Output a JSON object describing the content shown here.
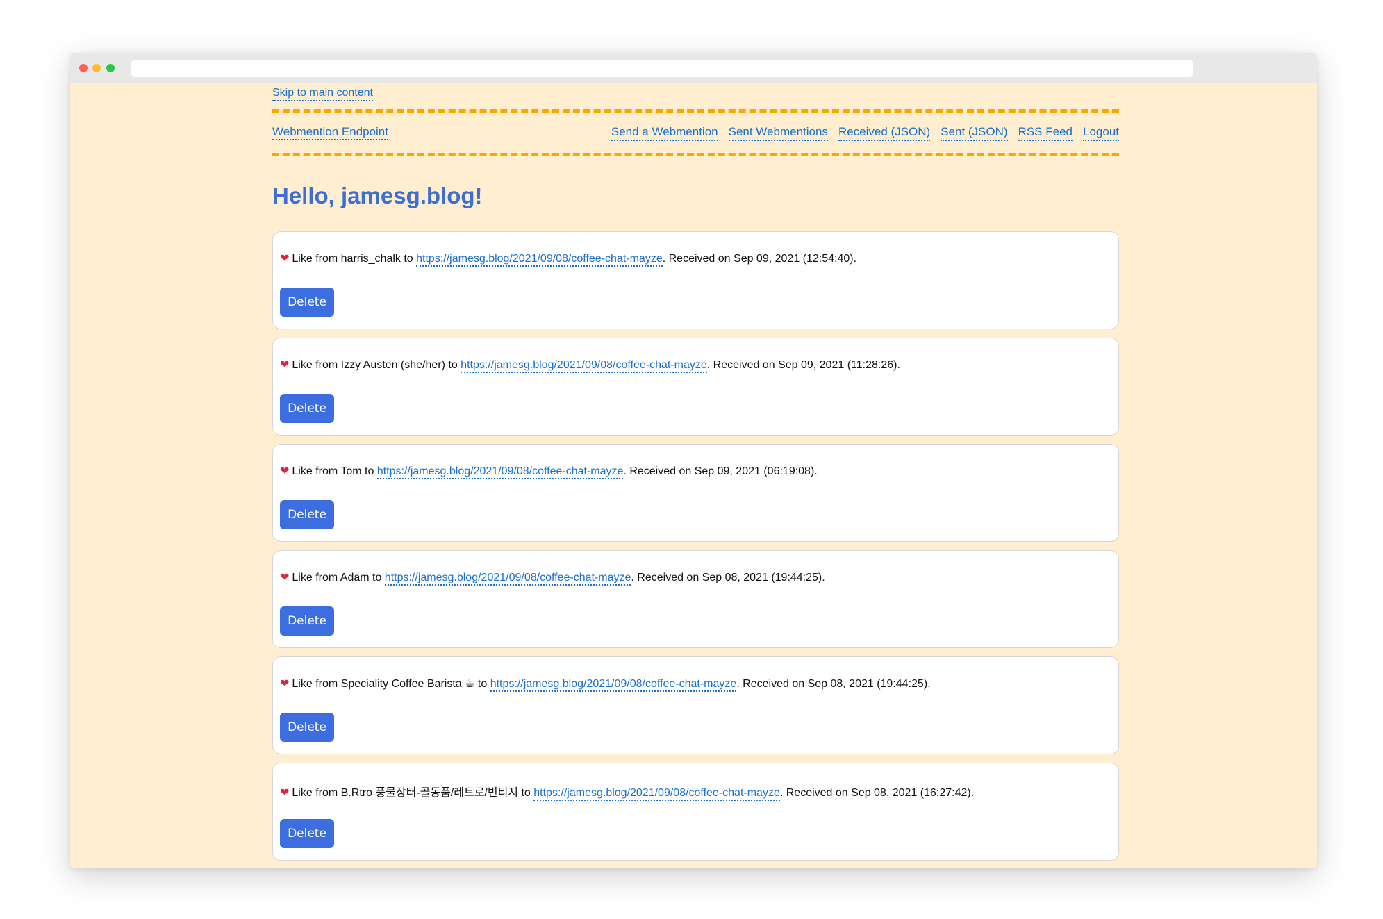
{
  "skip_link": "Skip to main content",
  "nav": {
    "brand": "Webmention Endpoint",
    "links": [
      "Send a Webmention",
      "Sent Webmentions",
      "Received (JSON)",
      "Sent (JSON)",
      "RSS Feed",
      "Logout"
    ]
  },
  "greeting": "Hello, jamesg.blog!",
  "webmentions": [
    {
      "icon": "heart-icon",
      "prefix": "Like from harris_chalk to ",
      "url": "https://jamesg.blog/2021/09/08/coffee-chat-mayze",
      "suffix": ". Received on Sep 09, 2021 (12:54:40).",
      "button": "Delete"
    },
    {
      "icon": "heart-icon",
      "prefix": "Like from Izzy Austen (she/her) to ",
      "url": "https://jamesg.blog/2021/09/08/coffee-chat-mayze",
      "suffix": ". Received on Sep 09, 2021 (11:28:26).",
      "button": "Delete"
    },
    {
      "icon": "heart-icon",
      "prefix": "Like from Tom to ",
      "url": "https://jamesg.blog/2021/09/08/coffee-chat-mayze",
      "suffix": ". Received on Sep 09, 2021 (06:19:08).",
      "button": "Delete"
    },
    {
      "icon": "heart-icon",
      "prefix": "Like from Adam to ",
      "url": "https://jamesg.blog/2021/09/08/coffee-chat-mayze",
      "suffix": ". Received on Sep 08, 2021 (19:44:25).",
      "button": "Delete"
    },
    {
      "icon": "heart-icon",
      "prefix": "Like from Speciality Coffee Barista ☕ to ",
      "url": "https://jamesg.blog/2021/09/08/coffee-chat-mayze",
      "suffix": ". Received on Sep 08, 2021 (19:44:25).",
      "button": "Delete"
    },
    {
      "icon": "heart-icon",
      "prefix": "Like from B.Rtro 풍물장터-골동품/레트로/빈티지 to ",
      "url": "https://jamesg.blog/2021/09/08/coffee-chat-mayze",
      "suffix": ". Received on Sep 08, 2021 (16:27:42).",
      "button": "Delete"
    }
  ],
  "colors": {
    "page_background": "#ffeed0",
    "accent_dashes": "#ffa500",
    "link": "#1a6fd0",
    "heading": "#3d6fd1",
    "button": "#3d6ee0",
    "heart": "#e0253f"
  }
}
